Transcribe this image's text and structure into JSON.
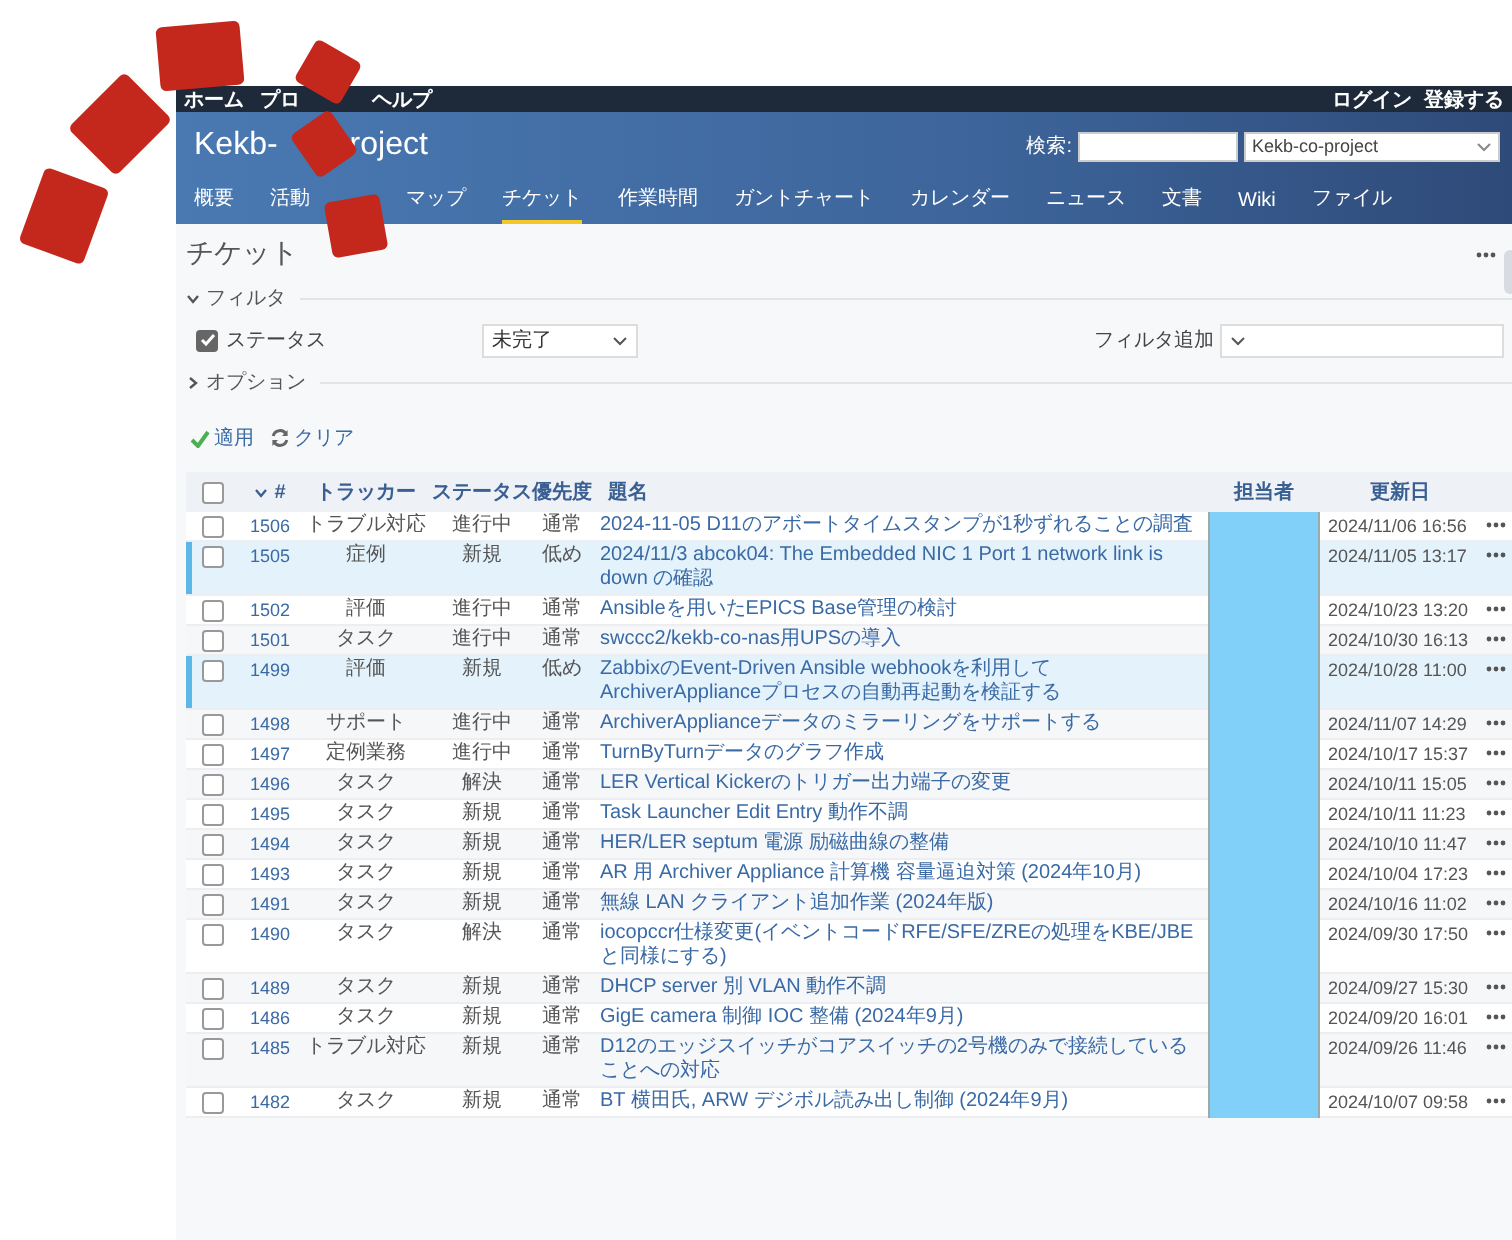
{
  "top_menu": [
    {
      "label": "ホーム"
    },
    {
      "label": "プロ"
    },
    {
      "label": "ヘルプ"
    }
  ],
  "account_menu": [
    {
      "label": "ログイン"
    },
    {
      "label": "登録する"
    }
  ],
  "header": {
    "title_parts": [
      "Kekb-",
      "roject"
    ],
    "search_label": "検索:",
    "project_select": "Kekb-co-project"
  },
  "tabs": [
    {
      "label": "概要",
      "selected": false
    },
    {
      "label": "活動",
      "selected": false
    },
    {
      "label": "マップ",
      "selected": false
    },
    {
      "label": "チケット",
      "selected": true
    },
    {
      "label": "作業時間",
      "selected": false
    },
    {
      "label": "ガントチャート",
      "selected": false
    },
    {
      "label": "カレンダー",
      "selected": false
    },
    {
      "label": "ニュース",
      "selected": false
    },
    {
      "label": "文書",
      "selected": false
    },
    {
      "label": "Wiki",
      "selected": false
    },
    {
      "label": "ファイル",
      "selected": false
    }
  ],
  "page_title": "チケット",
  "filters": {
    "legend": "フィルタ",
    "expanded": true,
    "status": {
      "label": "ステータス",
      "checked": true,
      "operator": "未完了"
    },
    "add_label": "フィルタ追加"
  },
  "options": {
    "legend": "オプション",
    "expanded": false
  },
  "actions": [
    {
      "kind": "apply",
      "label": "適用"
    },
    {
      "kind": "clear",
      "label": "クリア"
    }
  ],
  "table": {
    "all_checked": false,
    "columns": [
      "#",
      "トラッカー",
      "ステータス",
      "優先度",
      "題名",
      "担当者",
      "更新日"
    ],
    "rows": [
      {
        "id": "1506",
        "tracker": "トラブル対応",
        "status": "進行中",
        "priority": "通常",
        "subject": "2024-11-05 D11のアボートタイムスタンプが1秒ずれることの調査",
        "updated": "2024/11/06 16:56",
        "checked": false,
        "highlighted": false
      },
      {
        "id": "1505",
        "tracker": "症例",
        "status": "新規",
        "priority": "低め",
        "subject": "2024/11/3 abcok04: The Embedded NIC 1 Port 1 network link is down の確認",
        "updated": "2024/11/05 13:17",
        "checked": false,
        "highlighted": true
      },
      {
        "id": "1502",
        "tracker": "評価",
        "status": "進行中",
        "priority": "通常",
        "subject": "Ansibleを用いたEPICS Base管理の検討",
        "updated": "2024/10/23 13:20",
        "checked": false,
        "highlighted": false
      },
      {
        "id": "1501",
        "tracker": "タスク",
        "status": "進行中",
        "priority": "通常",
        "subject": "swccc2/kekb-co-nas用UPSの導入",
        "updated": "2024/10/30 16:13",
        "checked": false,
        "highlighted": false
      },
      {
        "id": "1499",
        "tracker": "評価",
        "status": "新規",
        "priority": "低め",
        "subject": "ZabbixのEvent-Driven Ansible webhookを利用してArchiverApplianceプロセスの自動再起動を検証する",
        "updated": "2024/10/28 11:00",
        "checked": false,
        "highlighted": true
      },
      {
        "id": "1498",
        "tracker": "サポート",
        "status": "進行中",
        "priority": "通常",
        "subject": "ArchiverApplianceデータのミラーリングをサポートする",
        "updated": "2024/11/07 14:29",
        "checked": false,
        "highlighted": false
      },
      {
        "id": "1497",
        "tracker": "定例業務",
        "status": "進行中",
        "priority": "通常",
        "subject": "TurnByTurnデータのグラフ作成",
        "updated": "2024/10/17 15:37",
        "checked": false,
        "highlighted": false
      },
      {
        "id": "1496",
        "tracker": "タスク",
        "status": "解決",
        "priority": "通常",
        "subject": "LER Vertical Kickerのトリガー出力端子の変更",
        "updated": "2024/10/11 15:05",
        "checked": false,
        "highlighted": false
      },
      {
        "id": "1495",
        "tracker": "タスク",
        "status": "新規",
        "priority": "通常",
        "subject": "Task Launcher Edit Entry 動作不調",
        "updated": "2024/10/11 11:23",
        "checked": false,
        "highlighted": false
      },
      {
        "id": "1494",
        "tracker": "タスク",
        "status": "新規",
        "priority": "通常",
        "subject": "HER/LER septum 電源 励磁曲線の整備",
        "updated": "2024/10/10 11:47",
        "checked": false,
        "highlighted": false
      },
      {
        "id": "1493",
        "tracker": "タスク",
        "status": "新規",
        "priority": "通常",
        "subject": "AR 用 Archiver Appliance 計算機 容量逼迫対策 (2024年10月)",
        "updated": "2024/10/04 17:23",
        "checked": false,
        "highlighted": false
      },
      {
        "id": "1491",
        "tracker": "タスク",
        "status": "新規",
        "priority": "通常",
        "subject": "無線 LAN クライアント追加作業 (2024年版)",
        "updated": "2024/10/16 11:02",
        "checked": false,
        "highlighted": false
      },
      {
        "id": "1490",
        "tracker": "タスク",
        "status": "解決",
        "priority": "通常",
        "subject": "iocopccr仕様変更(イベントコードRFE/SFE/ZREの処理をKBE/JBEと同様にする)",
        "updated": "2024/09/30 17:50",
        "checked": false,
        "highlighted": false
      },
      {
        "id": "1489",
        "tracker": "タスク",
        "status": "新規",
        "priority": "通常",
        "subject": "DHCP server 別 VLAN 動作不調",
        "updated": "2024/09/27 15:30",
        "checked": false,
        "highlighted": false
      },
      {
        "id": "1486",
        "tracker": "タスク",
        "status": "新規",
        "priority": "通常",
        "subject": "GigE camera 制御 IOC 整備 (2024年9月)",
        "updated": "2024/09/20 16:01",
        "checked": false,
        "highlighted": false
      },
      {
        "id": "1485",
        "tracker": "トラブル対応",
        "status": "新規",
        "priority": "通常",
        "subject": "D12のエッジスイッチがコアスイッチの2号機のみで接続していることへの対応",
        "updated": "2024/09/26 11:46",
        "checked": false,
        "highlighted": false
      },
      {
        "id": "1482",
        "tracker": "タスク",
        "status": "新規",
        "priority": "通常",
        "subject": "BT 横田氏, ARW デジボル読み出し制御 (2024年9月)",
        "updated": "2024/10/07 09:58",
        "checked": false,
        "highlighted": false
      }
    ]
  }
}
